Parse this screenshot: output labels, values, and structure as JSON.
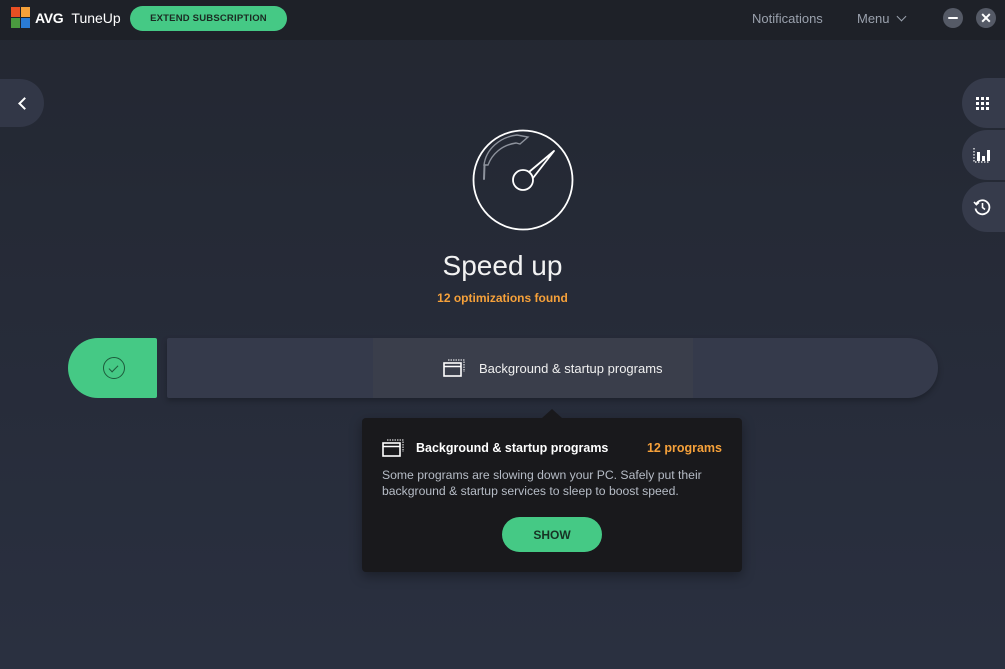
{
  "app": {
    "brand": "AVG",
    "product": "TuneUp",
    "logo_colors": [
      "#e94f23",
      "#f6a13a",
      "#4a9a3f",
      "#2a7bd4"
    ]
  },
  "titlebar": {
    "extend_label": "EXTEND SUBSCRIPTION",
    "notifications_label": "Notifications",
    "menu_label": "Menu",
    "minimize_icon": "minimize-icon",
    "close_icon": "close-icon",
    "close_glyph": "✕"
  },
  "side_nav": {
    "back_icon": "chevron-left-icon",
    "buttons": [
      {
        "icon": "grid-icon"
      },
      {
        "icon": "bar-chart-icon"
      },
      {
        "icon": "history-icon"
      }
    ]
  },
  "main": {
    "icon": "speedometer-icon",
    "title": "Speed up",
    "subtitle": "12 optimizations found",
    "accent_color": "#f6a13a",
    "green": "#45c985"
  },
  "progress_bar": {
    "completed_icon": "check-circle-icon",
    "active_segment_label": "Background & startup programs",
    "active_segment_icon": "window-icon"
  },
  "popup": {
    "title": "Background & startup programs",
    "count": "12 programs",
    "description": "Some programs are slowing down your PC. Safely put their background & startup services to sleep to boost speed.",
    "show_label": "SHOW"
  }
}
